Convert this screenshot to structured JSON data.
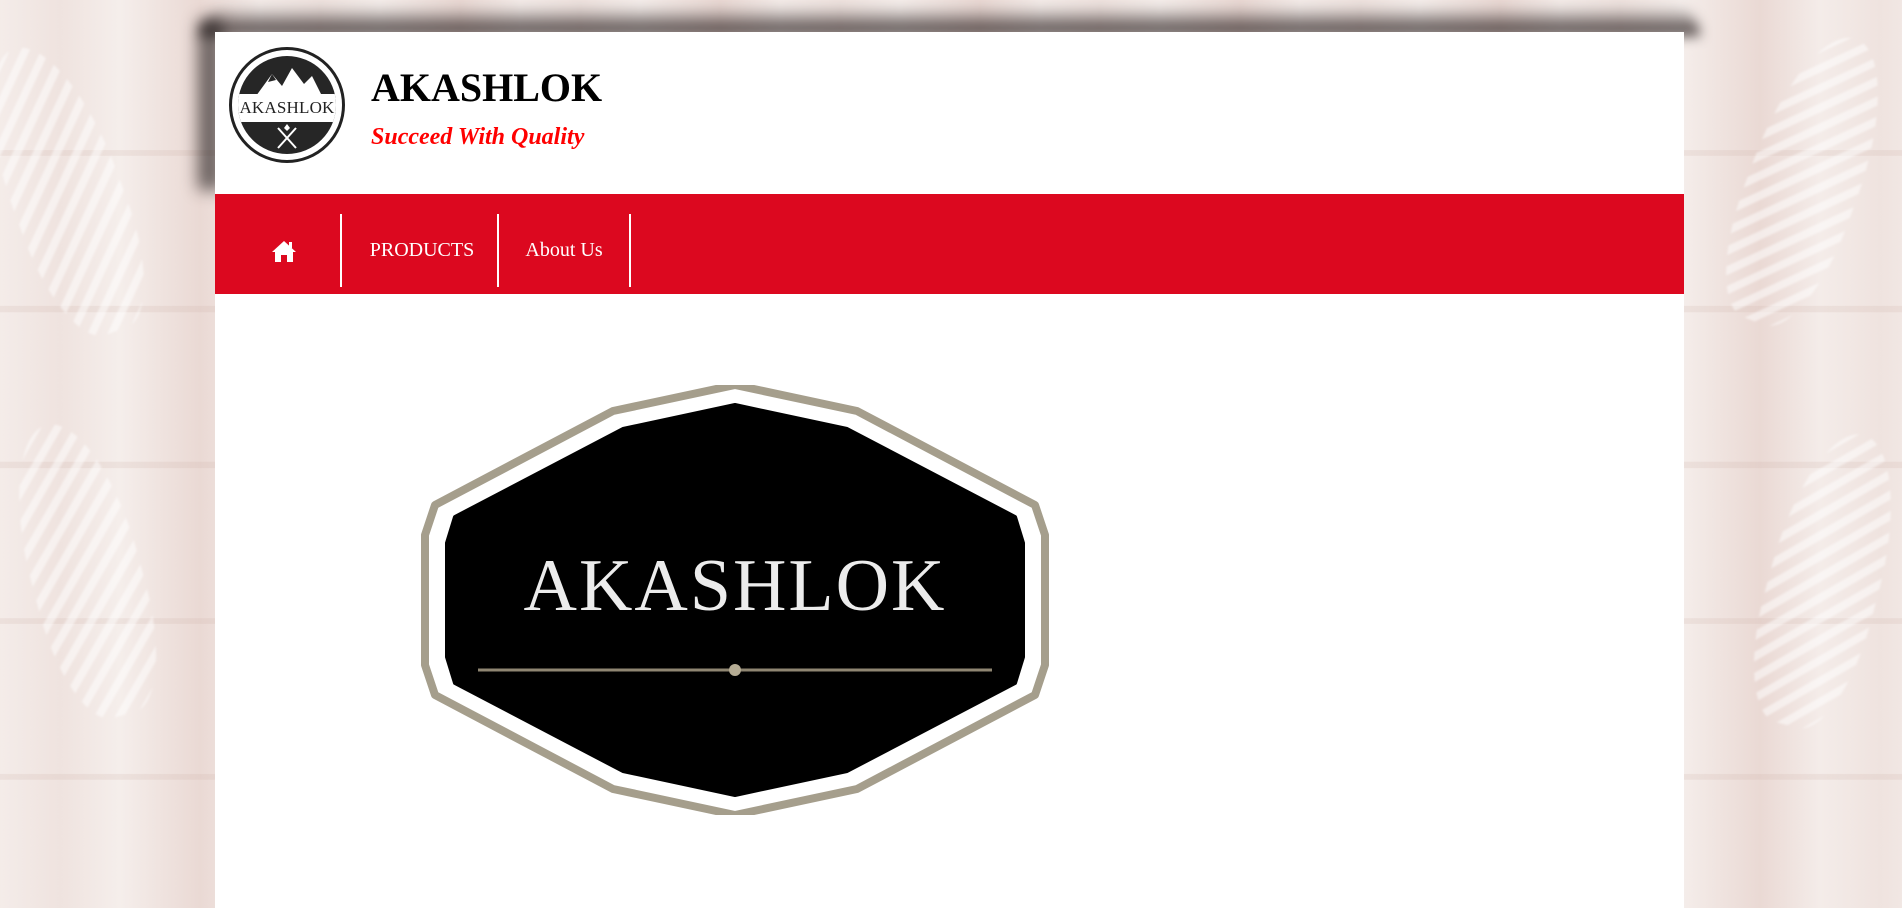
{
  "header": {
    "logo_text": "AKASHLOK",
    "title": "AKASHLOK",
    "tagline": "Succeed With Quality"
  },
  "nav": {
    "home_icon": "home-icon",
    "items": [
      {
        "label": "PRODUCTS"
      },
      {
        "label": "About Us"
      }
    ]
  },
  "hero": {
    "badge_text": "AKASHLOK"
  },
  "colors": {
    "nav_red": "#dc081f",
    "tagline_red": "#ff0000",
    "page_bg": "#ffffff"
  }
}
